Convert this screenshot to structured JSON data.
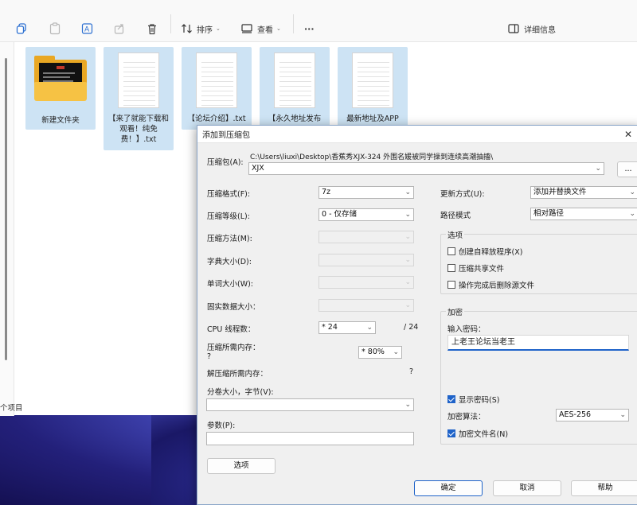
{
  "toolbar": {
    "sort_label": "排序",
    "view_label": "查看",
    "more_label": "···",
    "details_label": "详细信息"
  },
  "files": [
    {
      "name": "新建文件夹",
      "type": "folder"
    },
    {
      "name": "【来了就能下载和观看！纯免费！】.txt",
      "type": "txt"
    },
    {
      "name": "【论坛介绍】.txt",
      "type": "txt"
    },
    {
      "name": "【永久地址发布",
      "type": "txt"
    },
    {
      "name": "最新地址及APP",
      "type": "txt"
    }
  ],
  "status_bar": "个项目",
  "dialog": {
    "title": "添加到压缩包",
    "archive_label": "压缩包(A):",
    "archive_path": "C:\\Users\\liuxi\\Desktop\\香蕉秀XJX-324 外围名媛被同学操到连续高潮抽搐\\",
    "archive_name": "XJX",
    "browse_label": "...",
    "format_label": "压缩格式(F):",
    "format_value": "7z",
    "level_label": "压缩等级(L):",
    "level_value": "0 - 仅存储",
    "method_label": "压缩方法(M):",
    "dict_label": "字典大小(D):",
    "word_label": "单词大小(W):",
    "solid_label": "固实数据大小：",
    "threads_label": "CPU 线程数：",
    "threads_value": "* 24",
    "threads_total": "/ 24",
    "mem_comp_label": "压缩所需内存：",
    "mem_comp_value": "?",
    "mem_percent": "* 80%",
    "mem_decomp_label": "解压缩所需内存：",
    "mem_decomp_value": "?",
    "split_label": "分卷大小，字节(V):",
    "split_value": "",
    "params_label": "参数(P):",
    "params_value": "",
    "options_button": "选项",
    "update_label": "更新方式(U):",
    "update_value": "添加并替换文件",
    "path_mode_label": "路径模式",
    "path_mode_value": "相对路径",
    "options_group": "选项",
    "opt_sfx": "创建自释放程序(X)",
    "opt_shared": "压缩共享文件",
    "opt_delete": "操作完成后删除源文件",
    "encrypt_group": "加密",
    "password_label": "输入密码：",
    "password_value": "上老王论坛当老王",
    "show_password": "显示密码(S)",
    "enc_method_label": "加密算法：",
    "enc_method_value": "AES-256",
    "encrypt_names": "加密文件名(N)",
    "ok_button": "确定",
    "cancel_button": "取消",
    "help_button": "帮助"
  },
  "colors": {
    "accent": "#1f63c9",
    "selection": "#cde3f4",
    "folder": "#f6c244"
  }
}
